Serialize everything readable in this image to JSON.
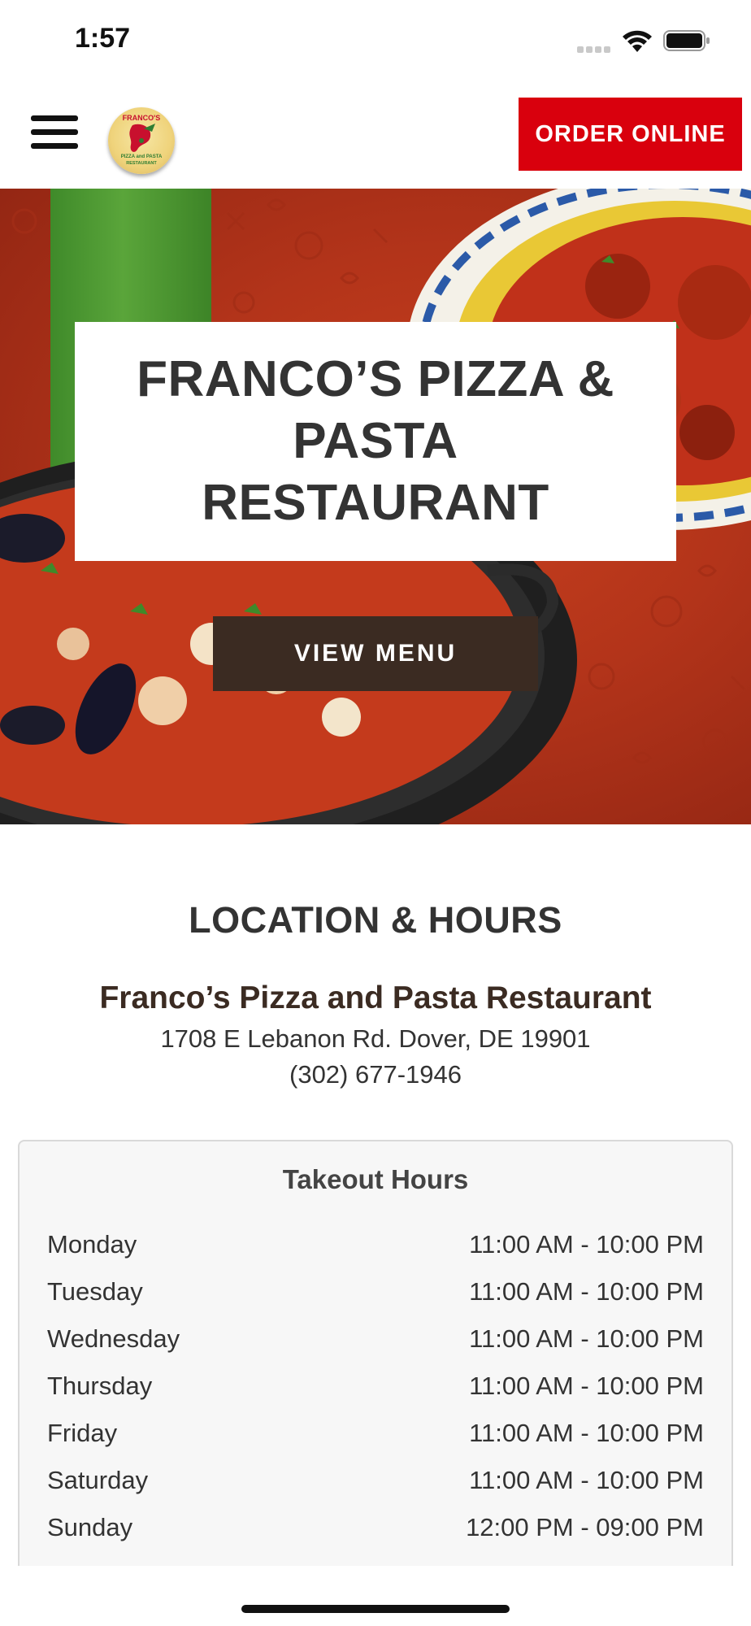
{
  "status_bar": {
    "time": "1:57"
  },
  "header": {
    "order_button_label": "ORDER ONLINE",
    "logo_text": "FRANCO'S PIZZA and PASTA RESTAURANT"
  },
  "hero": {
    "title": "FRANCO’S PIZZA & PASTA RESTAURANT",
    "view_menu_label": "VIEW MENU"
  },
  "location": {
    "heading": "LOCATION & HOURS",
    "restaurant_name": "Franco’s Pizza and Pasta Restaurant",
    "address": "1708 E Lebanon Rd. Dover, DE 19901",
    "phone": "(302) 677-1946",
    "hours_title": "Takeout Hours",
    "hours": [
      {
        "day": "Monday",
        "time": "11:00 AM - 10:00 PM"
      },
      {
        "day": "Tuesday",
        "time": "11:00 AM - 10:00 PM"
      },
      {
        "day": "Wednesday",
        "time": "11:00 AM - 10:00 PM"
      },
      {
        "day": "Thursday",
        "time": "11:00 AM - 10:00 PM"
      },
      {
        "day": "Friday",
        "time": "11:00 AM - 10:00 PM"
      },
      {
        "day": "Saturday",
        "time": "11:00 AM - 10:00 PM"
      },
      {
        "day": "Sunday",
        "time": "12:00 PM - 09:00 PM"
      }
    ]
  },
  "colors": {
    "order_button": "#d9000d",
    "view_menu_button": "#3b2b22",
    "hero_red": "#b3341a",
    "stripe_green": "#4f9a33"
  },
  "icons": [
    "signal-icon",
    "wifi-icon",
    "battery-icon",
    "hamburger-menu-icon",
    "logo"
  ]
}
